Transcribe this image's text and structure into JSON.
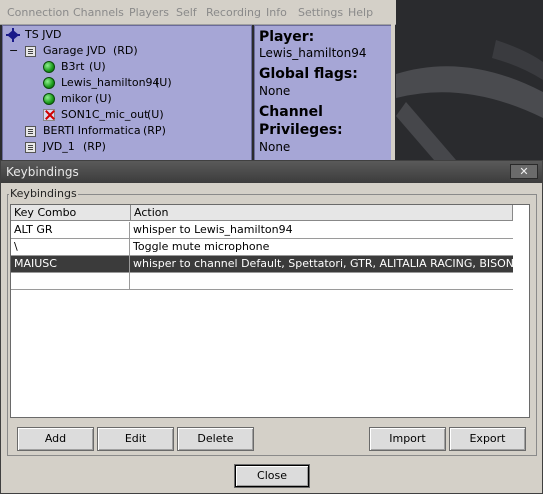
{
  "menubar": [
    "Connection",
    "Channels",
    "Players",
    "Self",
    "Recording",
    "Info",
    "Settings",
    "Help"
  ],
  "tree": {
    "server": "TS JVD",
    "expander": "−",
    "rows": [
      {
        "label": "Garage JVD",
        "flags": "(RD)"
      },
      {
        "label": "B3rt",
        "flags": "(U)"
      },
      {
        "label": "Lewis_hamilton94",
        "flags": "(U)"
      },
      {
        "label": "mikor",
        "flags": "(U)"
      },
      {
        "label": "SON1C_mic_out",
        "flags": "(U)"
      },
      {
        "label": "BERTI Informatica",
        "flags": "(RP)"
      },
      {
        "label": "JVD_1",
        "flags": "(RP)"
      }
    ]
  },
  "info": {
    "player_label": "Player:",
    "player_value": "Lewis_hamilton94",
    "global_flags_label": "Global flags:",
    "global_flags_value": "None",
    "channel_label_1": "Channel",
    "channel_label_2": "Privileges:",
    "channel_value": "None"
  },
  "dialog": {
    "title": "Keybindings",
    "close_glyph": "✕",
    "group_label": "Keybindings",
    "columns": [
      "Key Combo",
      "Action"
    ],
    "rows": [
      {
        "key": "ALT GR",
        "action": "whisper to Lewis_hamilton94",
        "selected": false
      },
      {
        "key": "\\",
        "action": "Toggle mute microphone",
        "selected": false
      },
      {
        "key": "MAIUSC",
        "action": "whisper to channel Default, Spettatori, GTR, ALITALIA RACING, BISONTI DA C",
        "selected": true
      }
    ],
    "buttons": {
      "add": "Add",
      "edit": "Edit",
      "delete": "Delete",
      "import": "Import",
      "export": "Export",
      "close": "Close"
    }
  },
  "colors": {
    "panel": "#a6a6d6",
    "dialog": "#d4d0c8",
    "selection": "#3b3b3b"
  }
}
